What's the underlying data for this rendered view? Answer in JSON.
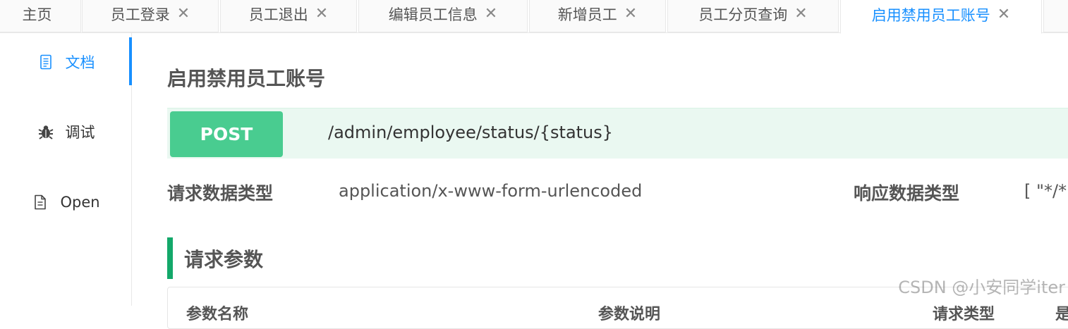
{
  "tabs": [
    {
      "label": "主页",
      "closable": false
    },
    {
      "label": "员工登录",
      "closable": true
    },
    {
      "label": "员工退出",
      "closable": true
    },
    {
      "label": "编辑员工信息",
      "closable": true
    },
    {
      "label": "新增员工",
      "closable": true
    },
    {
      "label": "员工分页查询",
      "closable": true
    },
    {
      "label": "启用禁用员工账号",
      "closable": true,
      "active": true
    }
  ],
  "close_glyph": "✕",
  "sidebar": {
    "items": [
      {
        "label": "文档",
        "icon": "document-icon",
        "active": true
      },
      {
        "label": "调试",
        "icon": "bug-icon",
        "active": false
      },
      {
        "label": "Open",
        "icon": "file-icon",
        "active": false
      }
    ]
  },
  "main": {
    "title": "启用禁用员工账号",
    "method": "POST",
    "path": "/admin/employee/status/{status}",
    "request_type_label": "请求数据类型",
    "request_type_value": "application/x-www-form-urlencoded",
    "response_type_label": "响应数据类型",
    "response_type_value": "[ \"*/*\"",
    "section_title": "请求参数",
    "table_headers": [
      "参数名称",
      "参数说明",
      "请求类型",
      "是"
    ]
  },
  "watermark": "CSDN @小安同学iter",
  "colors": {
    "accent": "#1890ff",
    "post_badge": "#49cc90",
    "post_bar": "#eaf8f1",
    "section_bar": "#13a86a"
  }
}
